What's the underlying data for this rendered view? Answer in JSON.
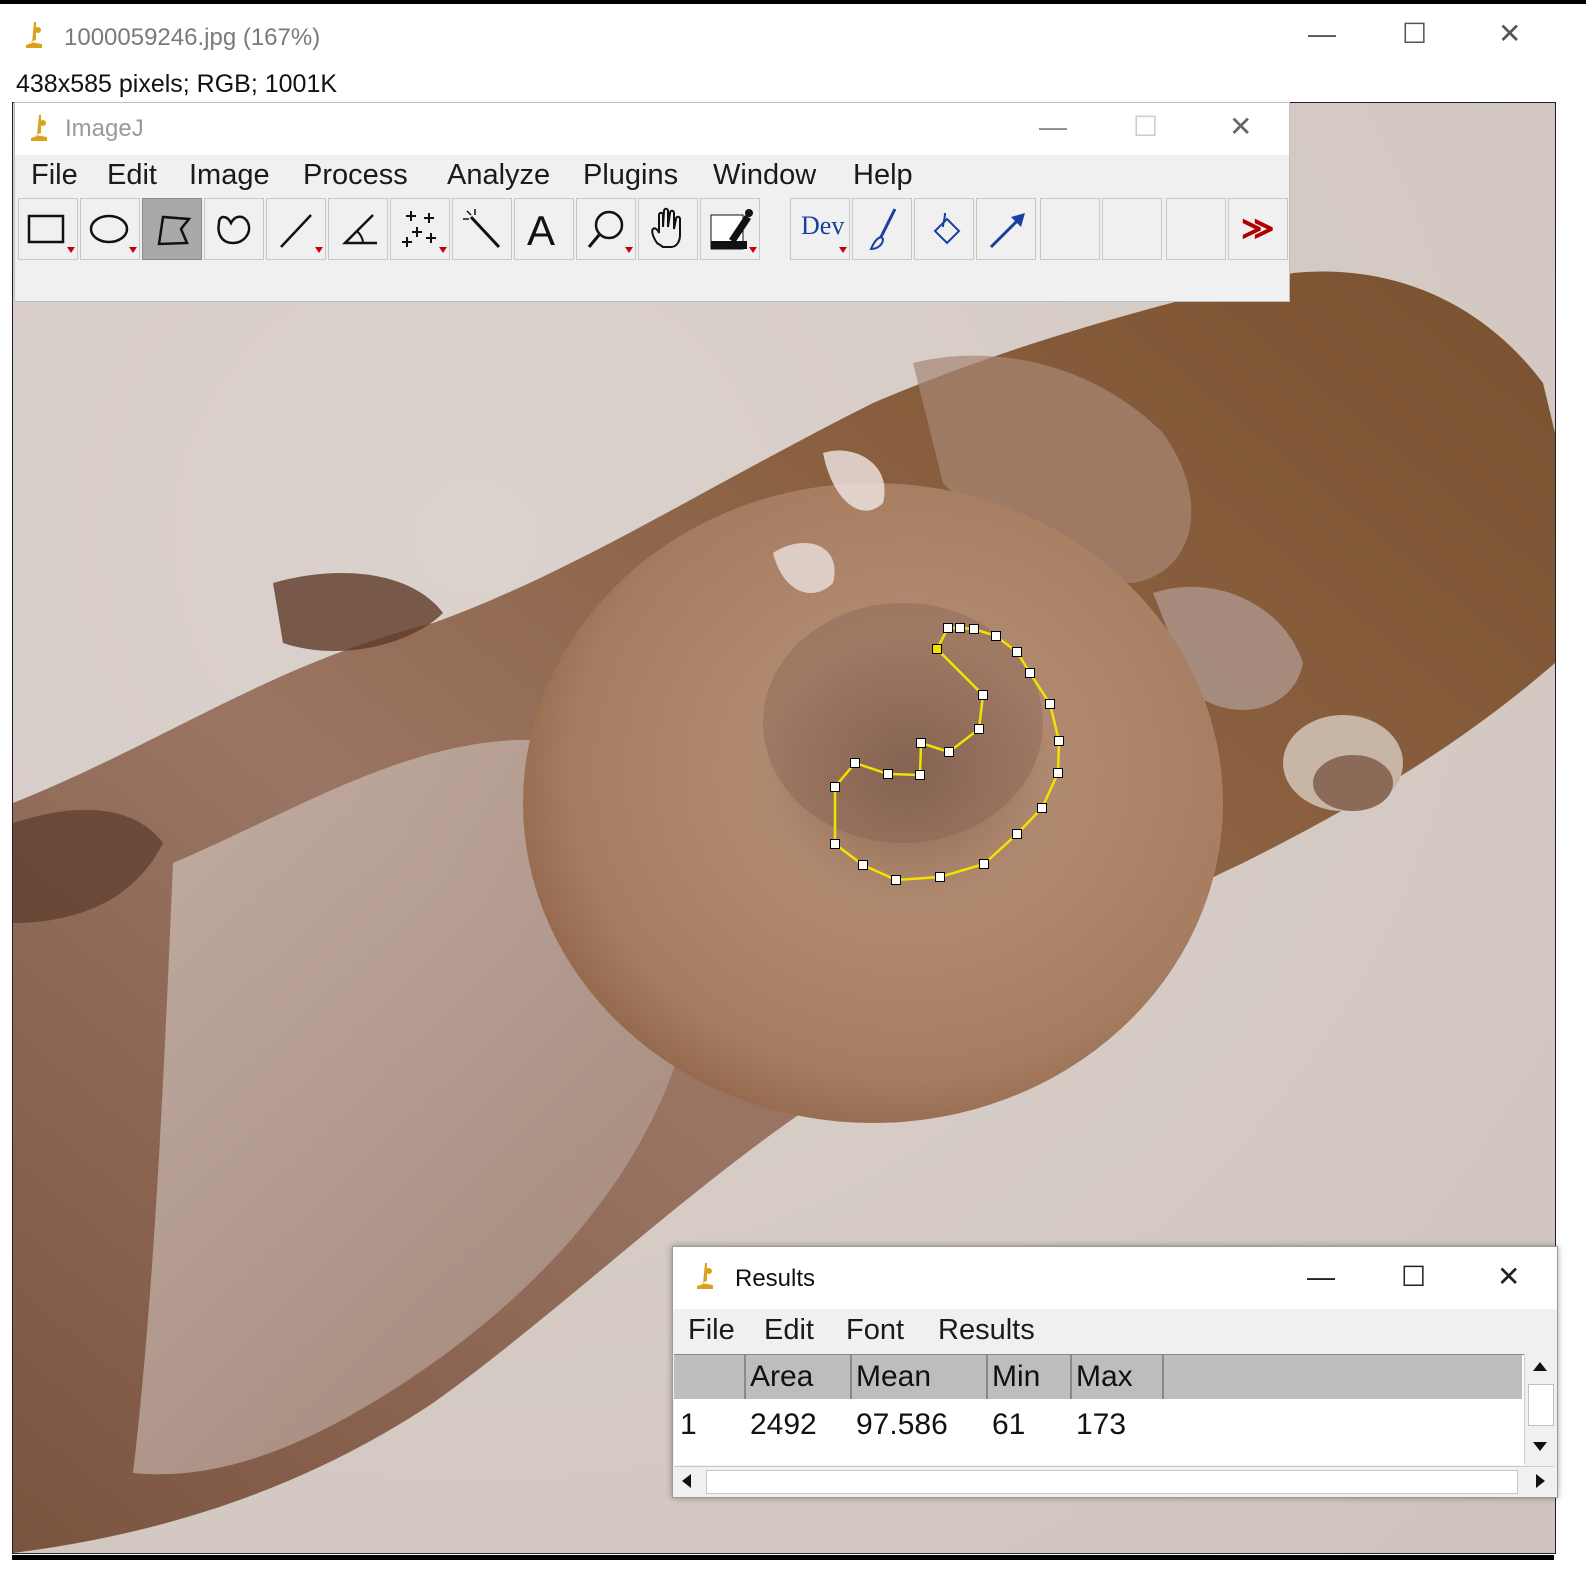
{
  "image_window": {
    "title": "1000059246.jpg (167%)",
    "info": "438x585 pixels; RGB; 1001K",
    "controls": {
      "minimize": "—",
      "maximize": "☐",
      "close": "✕"
    }
  },
  "imagej_window": {
    "title": "ImageJ",
    "menu": [
      "File",
      "Edit",
      "Image",
      "Process",
      "Analyze",
      "Plugins",
      "Window",
      "Help"
    ],
    "tools": [
      {
        "name": "rectangle-tool",
        "icon": "rectangle-icon"
      },
      {
        "name": "oval-tool",
        "icon": "oval-icon"
      },
      {
        "name": "polygon-tool",
        "icon": "polygon-icon",
        "selected": true
      },
      {
        "name": "freehand-tool",
        "icon": "freehand-icon"
      },
      {
        "name": "line-tool",
        "icon": "line-icon"
      },
      {
        "name": "angle-tool",
        "icon": "angle-icon"
      },
      {
        "name": "point-tool",
        "icon": "multipoint-icon"
      },
      {
        "name": "wand-tool",
        "icon": "wand-icon"
      },
      {
        "name": "text-tool",
        "icon": "text-icon",
        "label": "A"
      },
      {
        "name": "magnifier-tool",
        "icon": "magnifier-icon"
      },
      {
        "name": "hand-tool",
        "icon": "hand-icon"
      },
      {
        "name": "color-picker-tool",
        "icon": "dropper-icon"
      },
      {
        "name": "developer-menu",
        "icon": "dev-icon",
        "label": "Dev"
      },
      {
        "name": "brush-tool",
        "icon": "brush-icon"
      },
      {
        "name": "flood-fill-tool",
        "icon": "flood-fill-icon"
      },
      {
        "name": "arrow-tool",
        "icon": "arrow-icon"
      },
      {
        "name": "more-tools",
        "icon": "double-chevron-icon",
        "label": "≫"
      }
    ]
  },
  "results_window": {
    "title": "Results",
    "menu": [
      "File",
      "Edit",
      "Font",
      "Results"
    ],
    "columns": [
      "",
      "Area",
      "Mean",
      "Min",
      "Max"
    ],
    "rows": [
      [
        "1",
        "2492",
        "97.586",
        "61",
        "173"
      ]
    ]
  },
  "colors": {
    "roi": "#f2e200",
    "background": "#d8cfca",
    "tissue_dark": "#6b4632",
    "tissue_mid": "#a27a5f",
    "nodule": "#b0876b"
  }
}
